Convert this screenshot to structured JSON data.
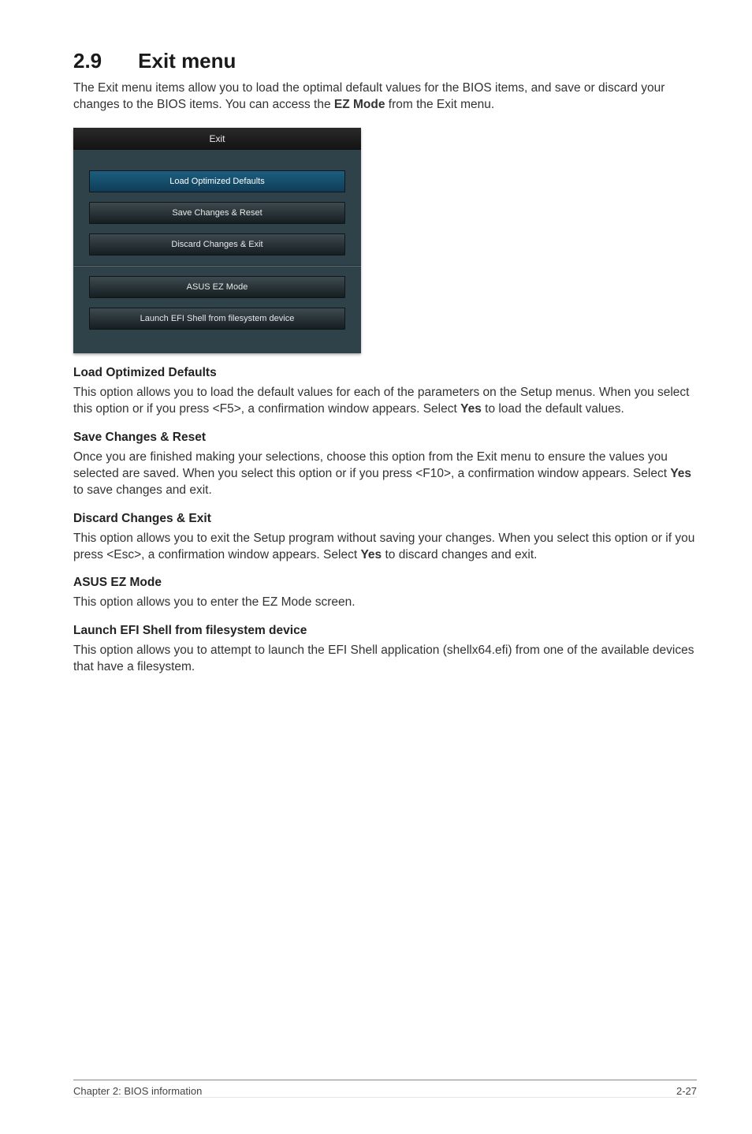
{
  "section": {
    "number": "2.9",
    "title": "Exit menu"
  },
  "intro": {
    "p1a": "The Exit menu items allow you to load the optimal default values for the BIOS items, and save or discard your changes to the BIOS items. You can access the ",
    "p1b": "EZ Mode",
    "p1c": " from the Exit menu."
  },
  "bios": {
    "title": "Exit",
    "btn_load": "Load Optimized Defaults",
    "btn_save": "Save Changes & Reset",
    "btn_discard": "Discard Changes & Exit",
    "btn_ez": "ASUS EZ Mode",
    "btn_efi": "Launch EFI Shell from filesystem device"
  },
  "sections": {
    "load": {
      "heading": "Load Optimized Defaults",
      "p_a": "This option allows you to load the default values for each of the parameters on the Setup menus. When you select this option or if you press <F5>, a confirmation window appears. Select ",
      "p_b": "Yes",
      "p_c": " to load the default values."
    },
    "save": {
      "heading": "Save Changes & Reset",
      "p_a": "Once you are finished making your selections, choose this option from the Exit menu to ensure the values you selected are saved. When you select this option or if you press <F10>, a confirmation window appears. Select ",
      "p_b": "Yes",
      "p_c": " to save changes and exit."
    },
    "discard": {
      "heading": "Discard Changes & Exit",
      "p_a": "This option allows you to exit the Setup program without saving your changes. When you select this option or if you press <Esc>, a confirmation window appears. Select ",
      "p_b": "Yes",
      "p_c": " to discard changes and exit."
    },
    "ez": {
      "heading": "ASUS EZ Mode",
      "p": "This option allows you to enter the EZ Mode screen."
    },
    "efi": {
      "heading": "Launch EFI Shell from filesystem device",
      "p": "This option allows you to attempt to launch the EFI Shell application (shellx64.efi) from one of the available devices that have a filesystem."
    }
  },
  "footer": {
    "left": "Chapter 2: BIOS information",
    "right": "2-27"
  }
}
